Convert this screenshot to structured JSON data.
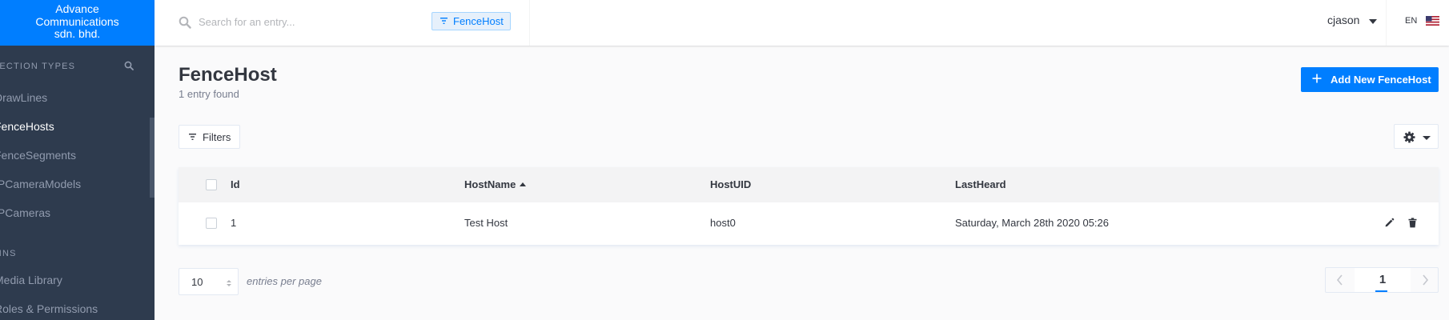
{
  "brand": {
    "line1": "Advance",
    "line2": "Communications",
    "line3": "sdn. bhd."
  },
  "sidebar": {
    "collection_header": "LECTION TYPES",
    "items": [
      {
        "label": "DrawLines",
        "active": false
      },
      {
        "label": "FenceHosts",
        "active": true
      },
      {
        "label": "FenceSegments",
        "active": false
      },
      {
        "label": "IPCameraModels",
        "active": false
      },
      {
        "label": "IPCameras",
        "active": false
      }
    ],
    "plugins_header": "GINS",
    "plugins": [
      {
        "label": "Media Library"
      },
      {
        "label": "Roles & Permissions"
      }
    ]
  },
  "topbar": {
    "search_placeholder": "Search for an entry...",
    "filter_tag": "FenceHost",
    "username": "cjason",
    "language": "EN"
  },
  "page": {
    "title": "FenceHost",
    "subtitle": "1 entry found",
    "add_button": "Add New FenceHost",
    "filters_button": "Filters"
  },
  "table": {
    "columns": [
      "Id",
      "HostName",
      "HostUID",
      "LastHeard"
    ],
    "sorted_column": "HostName",
    "sort_direction": "ascending",
    "rows": [
      {
        "id": "1",
        "hostname": "Test Host",
        "hostuid": "host0",
        "lastheard": "Saturday, March 28th 2020 05:26"
      }
    ]
  },
  "footer": {
    "per_page_value": "10",
    "per_page_label": "entries per page",
    "current_page": "1"
  },
  "colors": {
    "accent": "#007eff",
    "sidebar_bg": "#2e3b4e",
    "text": "#333740"
  }
}
